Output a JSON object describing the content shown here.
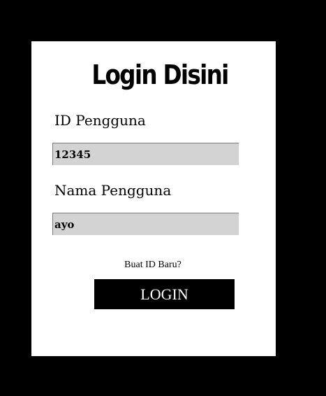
{
  "page": {
    "background": "#000000",
    "card_background": "#ffffff"
  },
  "form": {
    "title": "Login Disini",
    "id_label": "ID Pengguna",
    "id_value": "12345",
    "name_label": "Nama Pengguna",
    "name_value": "ayo",
    "field_background": "#d3d3d3",
    "new_id_link": "Buat ID Baru?",
    "login_button": "LOGIN"
  }
}
